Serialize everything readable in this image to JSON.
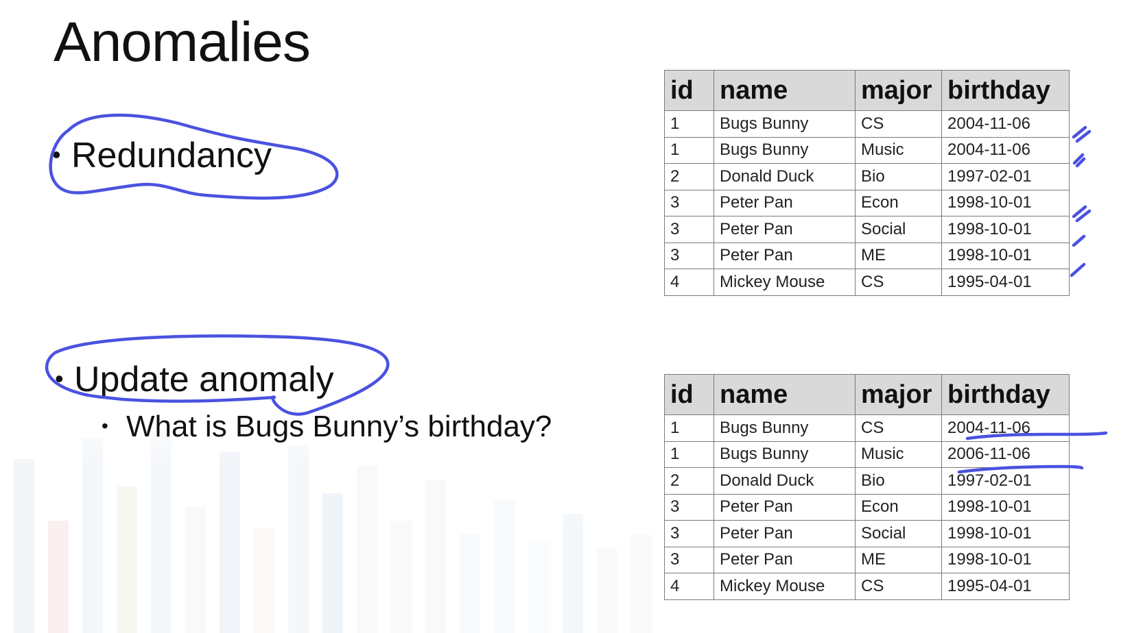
{
  "title": "Anomalies",
  "bullets": {
    "redundancy": "Redundancy",
    "update_anomaly": "Update anomaly",
    "question": "What is Bugs Bunny’s birthday?"
  },
  "tables": {
    "headers": [
      "id",
      "name",
      "major",
      "birthday"
    ],
    "top": {
      "rows": [
        [
          "1",
          "Bugs Bunny",
          "CS",
          "2004-11-06"
        ],
        [
          "1",
          "Bugs Bunny",
          "Music",
          "2004-11-06"
        ],
        [
          "2",
          "Donald Duck",
          "Bio",
          "1997-02-01"
        ],
        [
          "3",
          "Peter Pan",
          "Econ",
          "1998-10-01"
        ],
        [
          "3",
          "Peter Pan",
          "Social",
          "1998-10-01"
        ],
        [
          "3",
          "Peter Pan",
          "ME",
          "1998-10-01"
        ],
        [
          "4",
          "Mickey Mouse",
          "CS",
          "1995-04-01"
        ]
      ]
    },
    "bottom": {
      "rows": [
        [
          "1",
          "Bugs Bunny",
          "CS",
          "2004-11-06"
        ],
        [
          "1",
          "Bugs Bunny",
          "Music",
          "2006-11-06"
        ],
        [
          "2",
          "Donald Duck",
          "Bio",
          "1997-02-01"
        ],
        [
          "3",
          "Peter Pan",
          "Econ",
          "1998-10-01"
        ],
        [
          "3",
          "Peter Pan",
          "Social",
          "1998-10-01"
        ],
        [
          "3",
          "Peter Pan",
          "ME",
          "1998-10-01"
        ],
        [
          "4",
          "Mickey Mouse",
          "CS",
          "1995-04-01"
        ]
      ]
    }
  },
  "colors": {
    "ink": "#4a52e0",
    "header_bg": "#d9d9d9",
    "text": "#111111"
  }
}
